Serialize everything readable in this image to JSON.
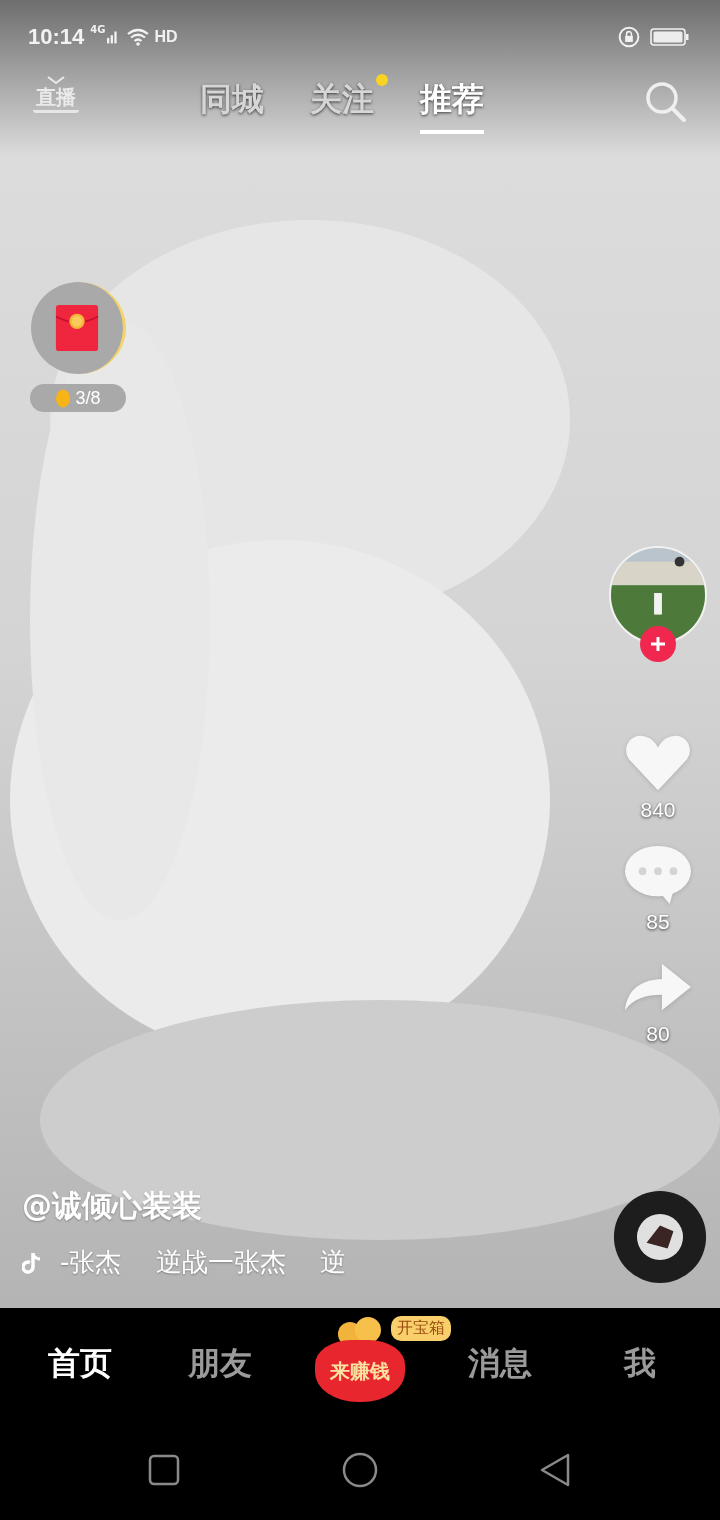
{
  "status_bar": {
    "time": "10:14",
    "network": "4G",
    "hd": "HD"
  },
  "top_nav": {
    "live_label": "直播",
    "tabs": [
      {
        "label": "同城",
        "selected": false,
        "dot": false
      },
      {
        "label": "关注",
        "selected": false,
        "dot": true
      },
      {
        "label": "推荐",
        "selected": true,
        "dot": false
      }
    ]
  },
  "reward": {
    "progress": "3/8"
  },
  "actions": [
    {
      "kind": "like",
      "count": "840"
    },
    {
      "kind": "comment",
      "count": "85"
    },
    {
      "kind": "share",
      "count": "80"
    }
  ],
  "author": "@诚倾心装装",
  "music": "-张杰　 逆战一张杰　 逆",
  "bottom_nav": {
    "items": [
      {
        "kind": "tab",
        "label": "首页",
        "selected": true
      },
      {
        "kind": "tab",
        "label": "朋友",
        "selected": false
      },
      {
        "kind": "earn",
        "label": "来赚钱",
        "badge": "开宝箱",
        "selected": false
      },
      {
        "kind": "tab",
        "label": "消息",
        "selected": false
      },
      {
        "kind": "tab",
        "label": "我",
        "selected": false
      }
    ]
  }
}
